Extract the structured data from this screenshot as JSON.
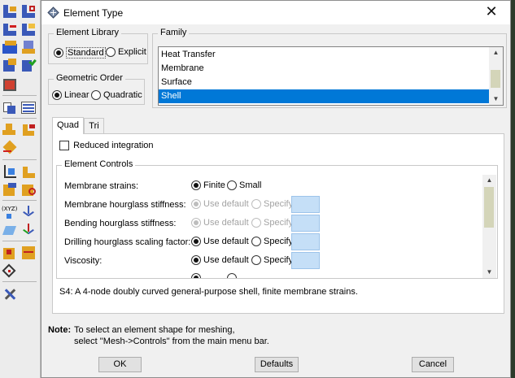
{
  "window": {
    "title": "Element Type",
    "close_label": "✕"
  },
  "element_library": {
    "legend": "Element Library",
    "options": [
      {
        "label": "Standard",
        "selected": true
      },
      {
        "label": "Explicit",
        "selected": false
      }
    ]
  },
  "geometric_order": {
    "legend": "Geometric Order",
    "options": [
      {
        "label": "Linear",
        "selected": true
      },
      {
        "label": "Quadratic",
        "selected": false
      }
    ]
  },
  "family": {
    "legend": "Family",
    "items": [
      "Heat Transfer",
      "Membrane",
      "Surface",
      "Shell"
    ],
    "selected": "Shell"
  },
  "tabs": [
    {
      "label": "Quad",
      "active": true
    },
    {
      "label": "Tri",
      "active": false
    }
  ],
  "reduced_integration": {
    "label": "Reduced integration",
    "checked": false
  },
  "element_controls": {
    "legend": "Element Controls",
    "rows": [
      {
        "label": "Membrane strains:",
        "opt1": "Finite",
        "opt2": "Small",
        "selected": "opt1",
        "enabled": true
      },
      {
        "label": "Membrane hourglass stiffness:",
        "opt1": "Use default",
        "opt2": "Specify",
        "selected": "opt1",
        "enabled": false
      },
      {
        "label": "Bending hourglass stiffness:",
        "opt1": "Use default",
        "opt2": "Specify",
        "selected": "opt1",
        "enabled": false
      },
      {
        "label": "Drilling hourglass scaling factor:",
        "opt1": "Use default",
        "opt2": "Specify",
        "selected": "opt1",
        "enabled": true
      },
      {
        "label": "Viscosity:",
        "opt1": "Use default",
        "opt2": "Specify",
        "selected": "opt1",
        "enabled": true
      }
    ]
  },
  "element_description": "S4:  A 4-node doubly curved general-purpose shell, finite membrane strains.",
  "note": {
    "label": "Note:",
    "line1": "To select an element shape for meshing,",
    "line2": "select \"Mesh->Controls\" from the main menu bar."
  },
  "buttons": {
    "ok": "OK",
    "defaults": "Defaults",
    "cancel": "Cancel"
  },
  "colors": {
    "selection": "#0078d7",
    "scroll_thumb": "#d4d5b9",
    "specify_box": "#c5dff7"
  },
  "toolbox_icons": [
    "mesh-part-icon",
    "mesh-region-icon",
    "seed-part-icon",
    "seed-edge-icon",
    "assign-mesh-controls-icon",
    "assign-element-type-icon",
    "verify-mesh-icon",
    "mesh-instance-icon",
    "partition-face-icon",
    "virtual-topology-icon",
    "edit-mesh-icon",
    "mesh-native-icon",
    "query-icon",
    "refine-icon",
    "create-node-icon",
    "datum-csys-icon",
    "datum-point-icon",
    "datum-axis-icon",
    "feature-icon",
    "model-tree-icon",
    "tools-icon"
  ]
}
